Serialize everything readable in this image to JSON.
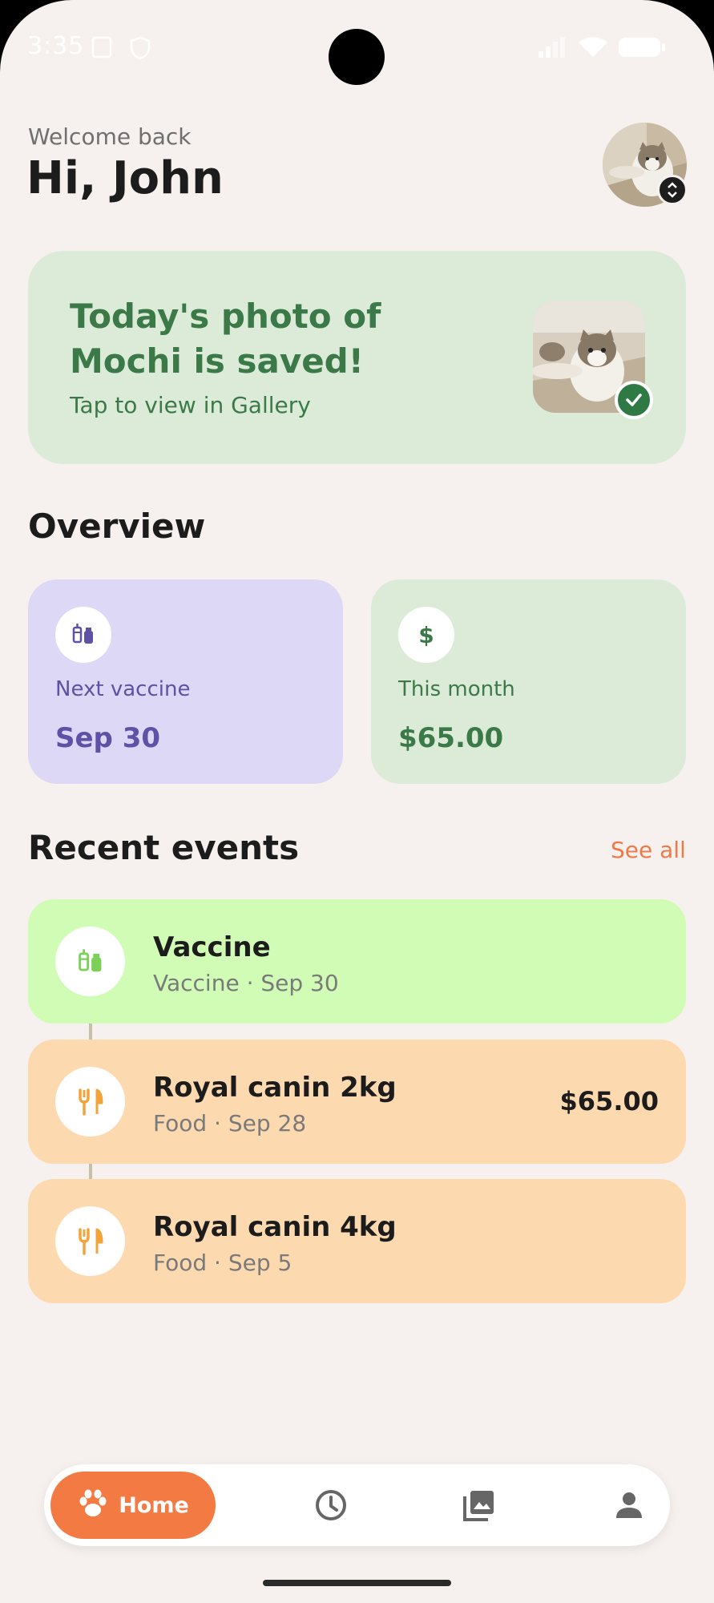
{
  "status": {
    "time": "3:35"
  },
  "header": {
    "welcome": "Welcome back",
    "greeting": "Hi, John"
  },
  "photo_card": {
    "title": "Today's photo of Mochi is saved!",
    "subtitle": "Tap to view in Gallery"
  },
  "overview": {
    "title": "Overview",
    "vaccine": {
      "label": "Next vaccine",
      "value": "Sep 30",
      "icon": "vaccine-icon"
    },
    "month": {
      "label": "This month",
      "value": "$65.00",
      "icon": "dollar-icon",
      "symbol": "$"
    }
  },
  "events": {
    "title": "Recent events",
    "see_all": "See all",
    "items": [
      {
        "title": "Vaccine",
        "subtitle": "Vaccine · Sep 30",
        "amount": "",
        "color": "#d1fcb6",
        "icon": "vaccine-icon"
      },
      {
        "title": "Royal canin 2kg",
        "subtitle": "Food · Sep 28",
        "amount": "$65.00",
        "color": "#fdd9b0",
        "icon": "food-icon"
      },
      {
        "title": "Royal canin 4kg",
        "subtitle": "Food · Sep 5",
        "amount": "",
        "color": "#fdd9b0",
        "icon": "food-icon"
      }
    ]
  },
  "nav": {
    "home_label": "Home"
  },
  "colors": {
    "accent": "#f47a44",
    "green": "#3b7a48",
    "purple": "#5e51a6",
    "background": "#f6f1ee"
  }
}
